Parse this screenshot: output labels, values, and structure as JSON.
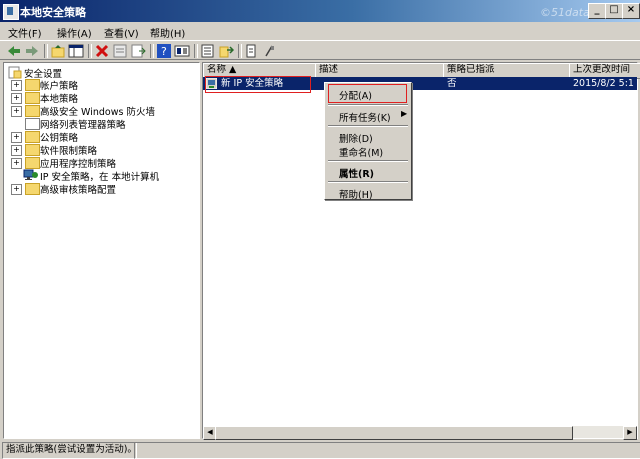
{
  "window": {
    "title": "本地安全策略",
    "watermark": "©51data.net"
  },
  "menubar": {
    "items": [
      {
        "label": "文件(F)"
      },
      {
        "label": "操作(A)"
      },
      {
        "label": "查看(V)"
      },
      {
        "label": "帮助(H)"
      }
    ]
  },
  "tree": {
    "root": "安全设置",
    "items": [
      {
        "label": "帐户策略"
      },
      {
        "label": "本地策略"
      },
      {
        "label": "高级安全 Windows 防火墙"
      },
      {
        "label": "网络列表管理器策略"
      },
      {
        "label": "公钥策略"
      },
      {
        "label": "软件限制策略"
      },
      {
        "label": "应用程序控制策略"
      },
      {
        "label": "IP 安全策略，在 本地计算机"
      },
      {
        "label": "高级审核策略配置"
      }
    ]
  },
  "list": {
    "columns": [
      {
        "label": "名称 ▲"
      },
      {
        "label": "描述"
      },
      {
        "label": "策略已指派"
      },
      {
        "label": "上次更改时间"
      }
    ],
    "rows": [
      {
        "name": "新 IP 安全策略",
        "description": "",
        "assigned": "否",
        "modified": "2015/8/2 5:1"
      }
    ]
  },
  "context_menu": {
    "items": [
      {
        "label": "分配(A)"
      },
      {
        "label": "所有任务(K)"
      },
      {
        "label": "删除(D)"
      },
      {
        "label": "重命名(M)"
      },
      {
        "label": "属性(R)"
      },
      {
        "label": "帮助(H)"
      }
    ]
  },
  "status": {
    "text": "指派此策略(尝试设置为活动)。"
  },
  "colors": {
    "titlebar": "#0a246a",
    "selection": "#0a246a",
    "highlight_box": "#e02020",
    "face": "#d4d0c8"
  }
}
